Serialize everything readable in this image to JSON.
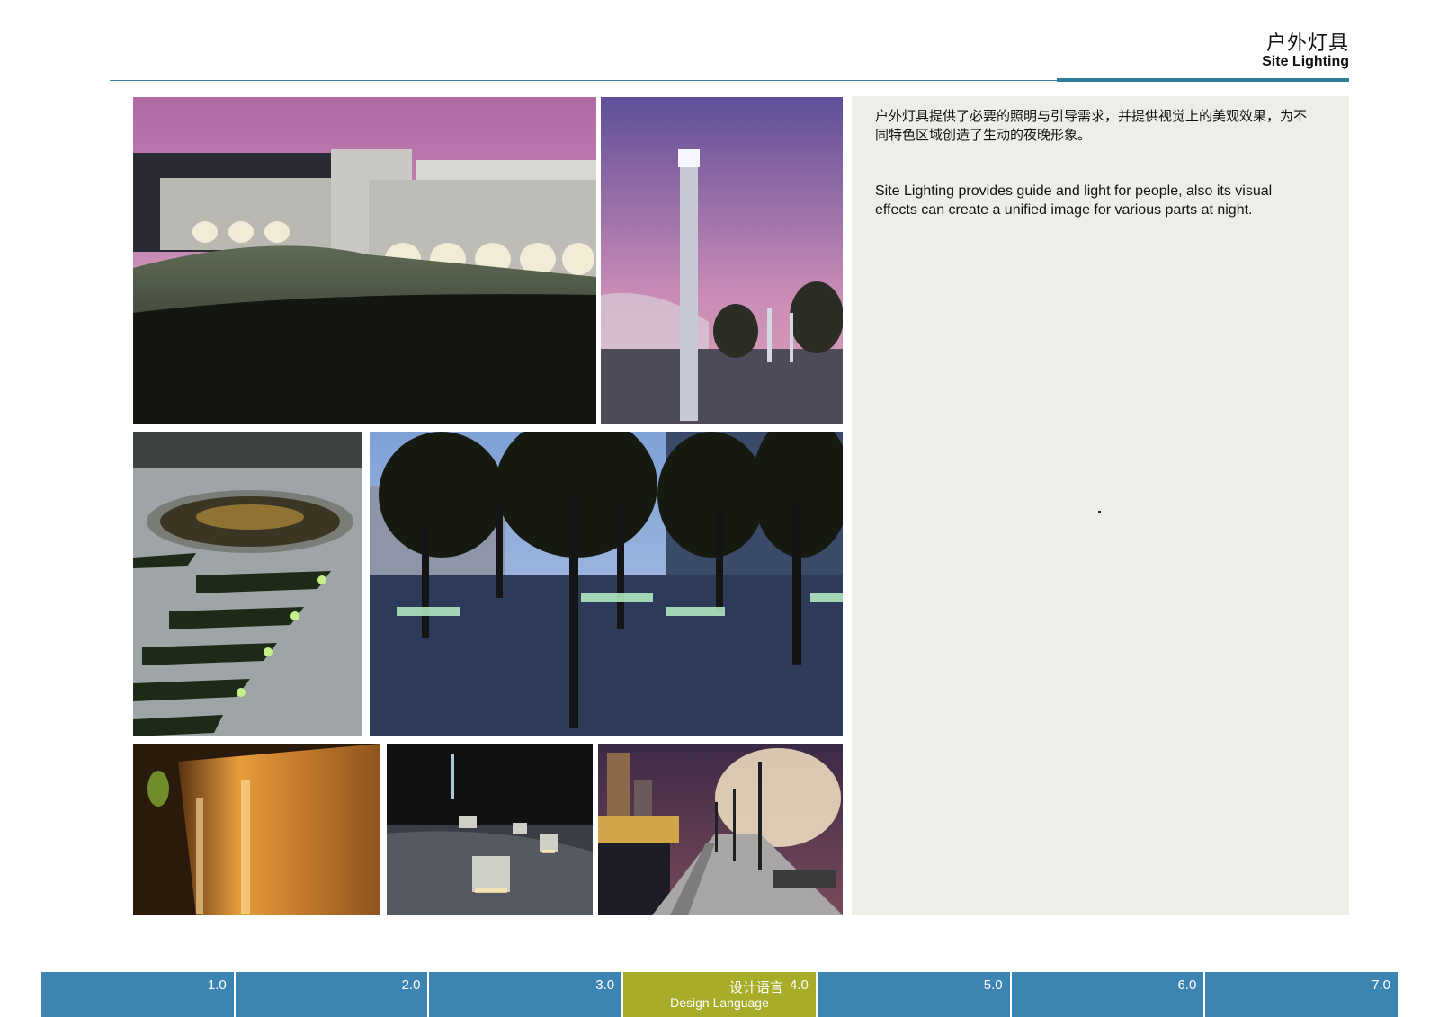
{
  "header": {
    "title_cn": "户外灯具",
    "title_en": "Site Lighting"
  },
  "description": {
    "cn": "户外灯具提供了必要的照明与引导需求，并提供视觉上的美观效果，为不同特色区域创造了生动的夜晚形象。",
    "en": "Site Lighting provides guide and light for people, also its visual effects can create a unified image for various parts at night."
  },
  "nav": {
    "items": [
      {
        "num": "1.0"
      },
      {
        "num": "2.0"
      },
      {
        "num": "3.0"
      },
      {
        "num": "4.0",
        "label_cn": "设计语言",
        "label_en": "Design Language",
        "active": true
      },
      {
        "num": "5.0"
      },
      {
        "num": "6.0"
      },
      {
        "num": "7.0"
      }
    ]
  },
  "colors": {
    "nav_blue": "#3c85b3",
    "nav_active": "#a7ad29",
    "rule": "#2f7d99",
    "panel": "#eeeee8"
  }
}
